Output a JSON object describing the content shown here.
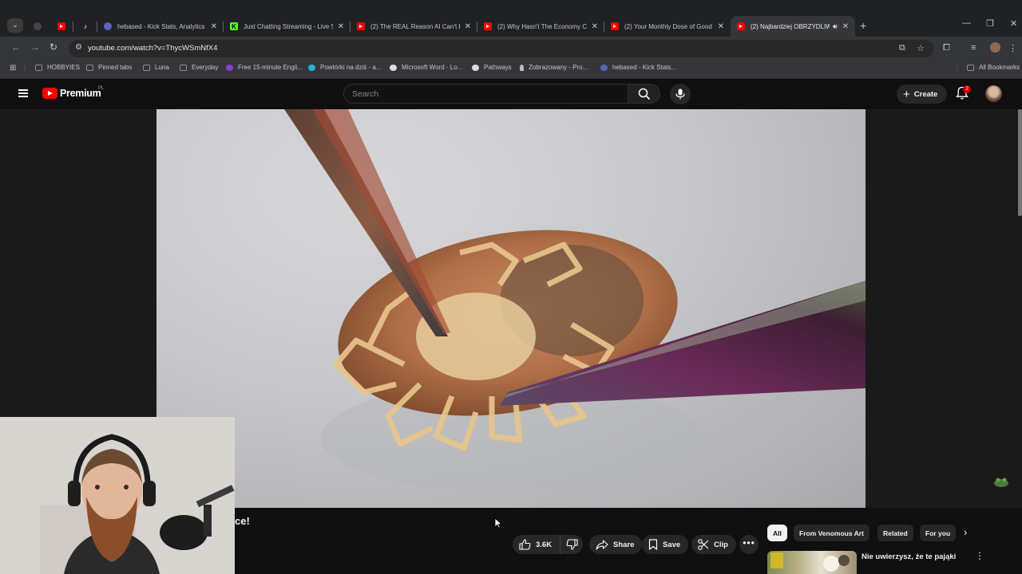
{
  "browser": {
    "tabs": [
      {
        "title": "",
        "favicon": "youtube-icon"
      },
      {
        "title": "",
        "favicon": "tiktok-icon"
      },
      {
        "title": "hebased - Kick Stats, Analytics a",
        "favicon": "kickstats-icon"
      },
      {
        "title": "Just Chatting Streaming - Live S",
        "favicon": "kick-icon"
      },
      {
        "title": "(2) The REAL Reason AI Can't B",
        "favicon": "youtube-icon"
      },
      {
        "title": "(2) Why Hasn't The Economy C",
        "favicon": "youtube-icon"
      },
      {
        "title": "(2) Your Monthly Dose of Good",
        "favicon": "youtube-icon"
      },
      {
        "title": "(2) Najbardziej OBRZYDLIW",
        "favicon": "youtube-icon",
        "active": true,
        "audio": true
      }
    ],
    "url": "youtube.com/watch?v=ThycWSmNfX4",
    "bookmarks": [
      {
        "label": "HOBBYIES",
        "icon": "folder-icon"
      },
      {
        "label": "Pinned tabs",
        "icon": "folder-icon"
      },
      {
        "label": "Luna",
        "icon": "folder-icon"
      },
      {
        "label": "Everyday",
        "icon": "folder-icon"
      },
      {
        "label": "Free 15-minute Engli...",
        "icon": "ef-icon"
      },
      {
        "label": "Powtórki na dziś - a...",
        "icon": "chat-icon"
      },
      {
        "label": "Microsoft Word - Lo...",
        "icon": "globe-icon"
      },
      {
        "label": "Pathways",
        "icon": "globe-icon"
      },
      {
        "label": "Zobrazowany - Pro...",
        "icon": "pin-icon"
      },
      {
        "label": "hebased - Kick Stats...",
        "icon": "kickstats-icon"
      }
    ],
    "all_bookmarks": "All Bookmarks"
  },
  "youtube": {
    "logo_text": "Premium",
    "region": "PL",
    "search_placeholder": "Search",
    "create_label": "Create",
    "notification_count": "2",
    "video_title_fragment": "ce!",
    "actions": {
      "likes": "3.6K",
      "share": "Share",
      "save": "Save",
      "clip": "Clip"
    },
    "chips": [
      "All",
      "From Venomous Art",
      "Related",
      "For you"
    ],
    "recommended": [
      {
        "title": "Nie uwierzysz, że te pająki"
      }
    ]
  },
  "colors": {
    "brand_red": "#ff0000",
    "bg": "#0f0f0f",
    "chip_bg": "#272727"
  }
}
